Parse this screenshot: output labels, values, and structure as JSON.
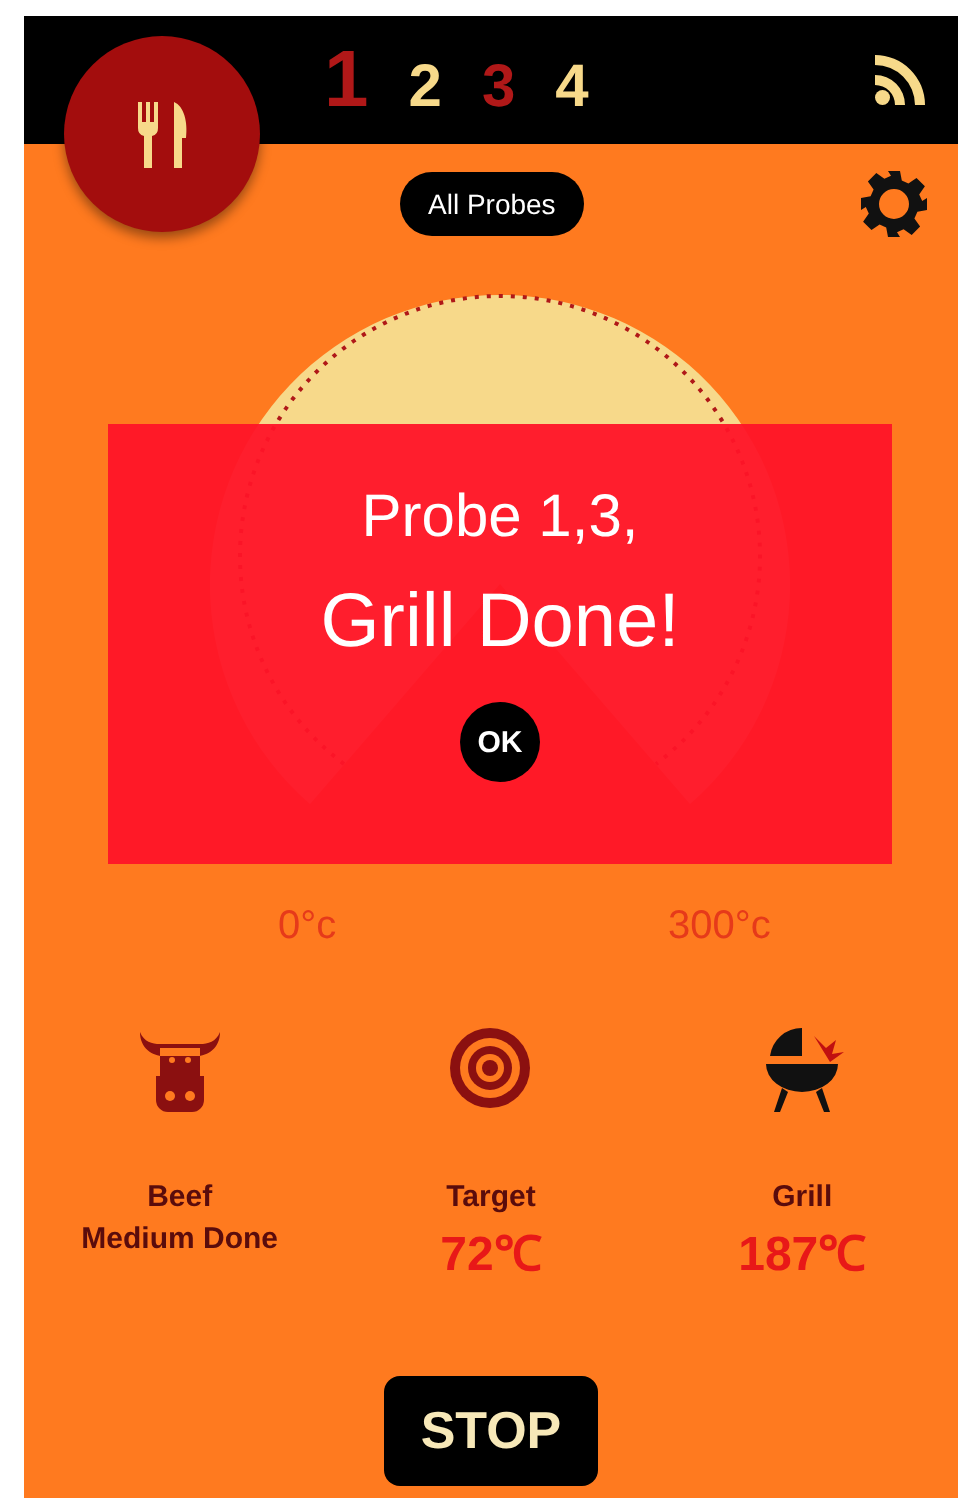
{
  "probe_tabs": [
    {
      "label": "1",
      "selected": true,
      "alert": true
    },
    {
      "label": "2",
      "selected": false,
      "alert": false
    },
    {
      "label": "3",
      "selected": false,
      "alert": true
    },
    {
      "label": "4",
      "selected": false,
      "alert": false
    }
  ],
  "probe_filter": "All Probes",
  "gauge": {
    "min_label": "0°c",
    "max_label": "300°c"
  },
  "alert_dialog": {
    "line_1": "Probe 1,3,",
    "line_2": "Grill Done!",
    "button": "OK"
  },
  "info": [
    {
      "kind": "meat",
      "label": "Beef\nMedium Done"
    },
    {
      "kind": "target",
      "label": "Target",
      "value": "72℃"
    },
    {
      "kind": "grill",
      "label": "Grill",
      "value": "187℃"
    }
  ],
  "stop_button": "STOP"
}
